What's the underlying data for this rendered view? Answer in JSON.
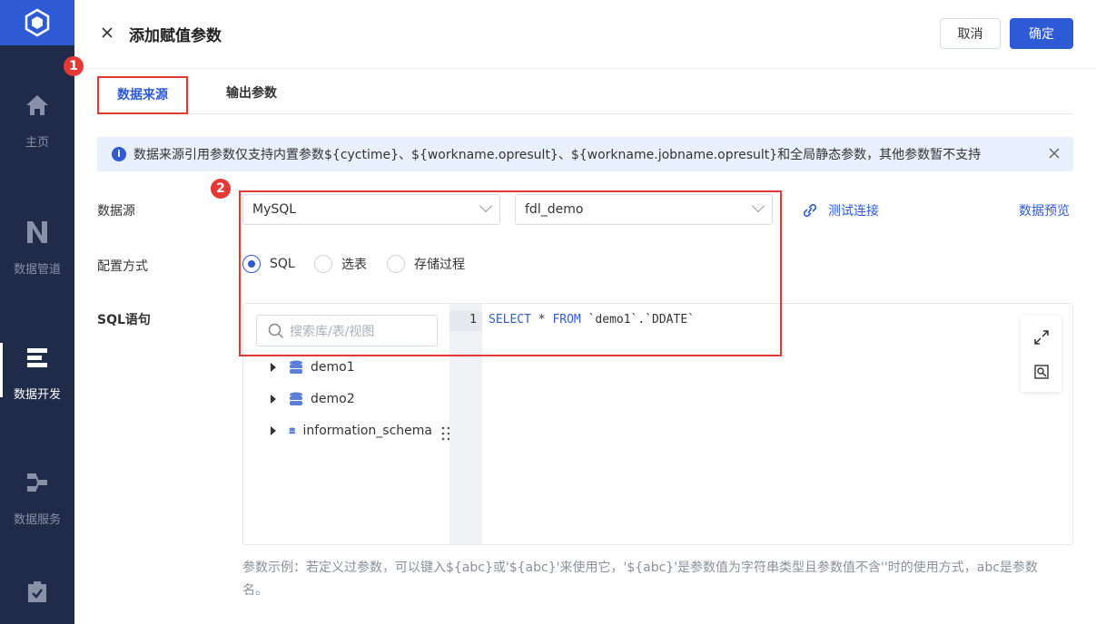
{
  "nav": {
    "items": [
      {
        "label": "主页",
        "icon": "home-icon"
      },
      {
        "label": "数据管道",
        "icon": "pipeline-icon"
      },
      {
        "label": "数据开发",
        "icon": "dev-icon"
      },
      {
        "label": "数据服务",
        "icon": "service-icon"
      },
      {
        "label": "",
        "icon": "task-icon"
      }
    ]
  },
  "header": {
    "title": "添加赋值参数",
    "cancel_label": "取消",
    "ok_label": "确定"
  },
  "badges": [
    "1",
    "2"
  ],
  "tabs": [
    {
      "label": "数据来源"
    },
    {
      "label": "输出参数"
    }
  ],
  "info": {
    "text": "数据来源引用参数仅支持内置参数${cyctime}、${workname.opresult}、${workname.jobname.opresult}和全局静态参数，其他参数暂不支持"
  },
  "form": {
    "datasource_label": "数据源",
    "datasource_type": "MySQL",
    "datasource_db": "fdl_demo",
    "test_connection_label": "测试连接",
    "preview_label": "数据预览",
    "config_label": "配置方式",
    "config_options": [
      "SQL",
      "选表",
      "存储过程"
    ],
    "config_selected": "SQL",
    "sql_label": "SQL语句"
  },
  "editor": {
    "search_placeholder": "搜索库/表/视图",
    "tree": [
      "demo1",
      "demo2",
      "information_schema"
    ],
    "line_number": "1",
    "code": {
      "kw1": "SELECT",
      "mid": " * ",
      "kw2": "FROM",
      "rest": " `demo1`.`DDATE`"
    }
  },
  "hint": "参数示例：若定义过参数，可以键入${abc}或'${abc}'来使用它，'${abc}'是参数值为字符串类型且参数值不含''时的使用方式，abc是参数名。",
  "colors": {
    "accent": "#2e5ad6",
    "highlight": "#e53935",
    "nav_bg": "#1f2b48"
  }
}
